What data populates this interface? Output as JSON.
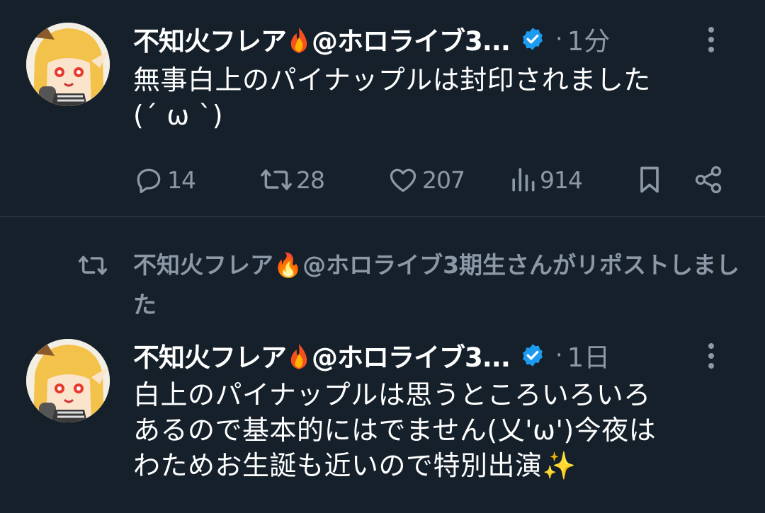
{
  "tweets": [
    {
      "author_name": "不知火フレア",
      "author_suffix": "@ホロライブ3...",
      "time": "1分",
      "text_lines": [
        "無事白上のパイナップルは封印されました",
        "(ˊ ω ˋ)"
      ],
      "counts": {
        "reply": "14",
        "repost": "28",
        "like": "207",
        "views": "914"
      }
    },
    {
      "repost_note": "不知火フレア🔥@ホロライブ3期生さんがリポストしました",
      "author_name": "不知火フレア",
      "author_suffix": "@ホロライブ3...",
      "time": "1日",
      "text_lines": [
        "白上のパイナップルは思うところいろいろ",
        "あるので基本的にはでません(乂'ω')今夜は",
        "わためお生誕も近いので特別出演✨"
      ]
    }
  ],
  "colors": {
    "background": "#15202b",
    "text": "#ffffff",
    "muted": "#8b98a5",
    "verified": "#1d9bf0",
    "divider": "#38444d"
  },
  "icons": [
    "flame-icon",
    "verified-badge-icon",
    "more-icon",
    "reply-icon",
    "repost-icon",
    "like-icon",
    "views-icon",
    "bookmark-icon",
    "share-icon"
  ]
}
